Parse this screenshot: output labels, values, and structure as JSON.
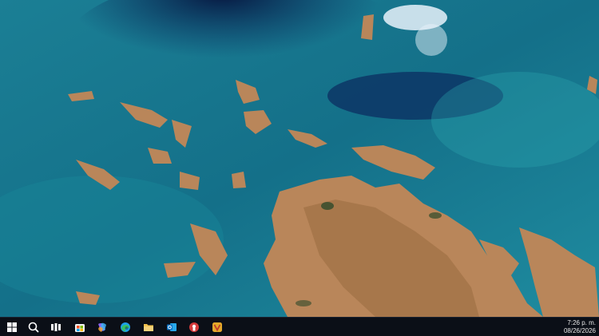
{
  "desktop": {
    "wallpaper": {
      "description_icon": "satellite-coastline-wallpaper",
      "colors": {
        "deep_sea": "#0a2a5e",
        "shallow_sea": "#1b7f95",
        "turquoise": "#2aa7ae",
        "land": "#b9865a",
        "land_dark": "#8a5a34",
        "cloud": "#e8f2fa"
      }
    }
  },
  "taskbar": {
    "background": "#0b0f17",
    "icons": [
      {
        "name": "start-icon",
        "color": "#ffffff"
      },
      {
        "name": "search-icon",
        "color": "#ffffff"
      },
      {
        "name": "task-view-icon",
        "color": "#ffffff"
      },
      {
        "name": "store-icon",
        "color": "#ffcc33"
      },
      {
        "name": "copilot-icon",
        "color": "#8a63f0"
      },
      {
        "name": "edge-icon",
        "color": "#1ea0e8"
      },
      {
        "name": "file-explorer-icon",
        "color": "#f2c14e"
      },
      {
        "name": "outlook-icon",
        "color": "#0a72c6"
      },
      {
        "name": "app-red-icon",
        "color": "#d63a3a"
      },
      {
        "name": "vivaldi-icon",
        "color": "#e4a82a"
      }
    ],
    "clock": {
      "time": "7:26 p. m.",
      "date": "08/26/2026"
    }
  }
}
